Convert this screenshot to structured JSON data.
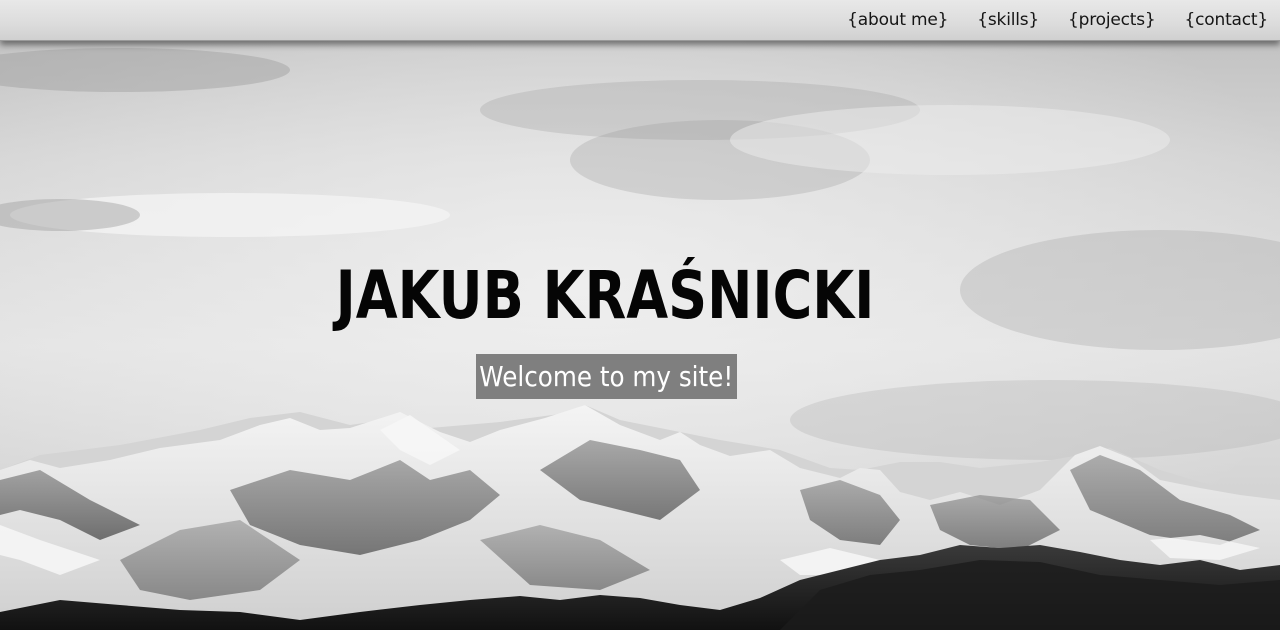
{
  "nav": {
    "items": [
      {
        "label": "{about me}"
      },
      {
        "label": "{skills}"
      },
      {
        "label": "{projects}"
      },
      {
        "label": "{contact}"
      }
    ]
  },
  "hero": {
    "title": "JAKUB KRAŚNICKI",
    "subtitle": "Welcome to my site!",
    "background": "mountain-landscape-image"
  },
  "colors": {
    "nav_bg": "#dcdcdc",
    "title": "#050505",
    "subtitle_bg": "#7f7f7f",
    "subtitle_text": "#ffffff"
  }
}
